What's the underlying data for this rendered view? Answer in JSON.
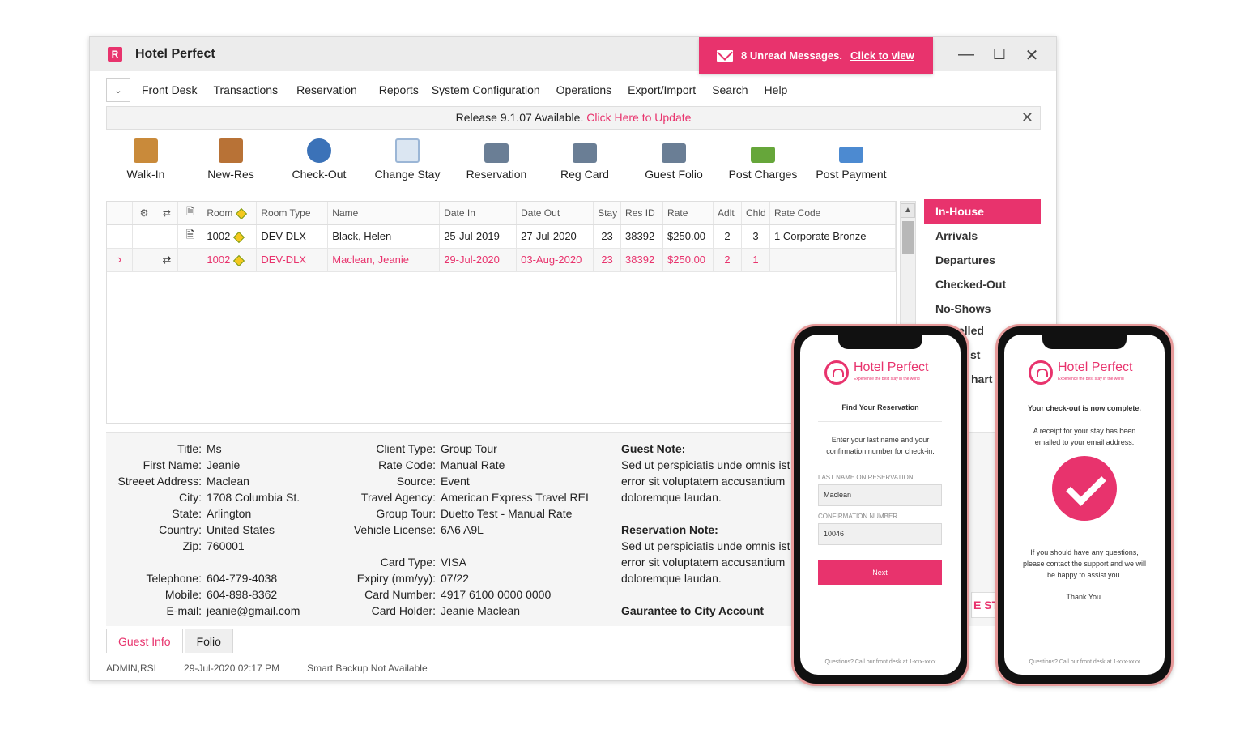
{
  "window": {
    "title": "Hotel Perfect",
    "logo_letter": "R",
    "controls": {
      "minimize": "—",
      "maximize": "☐",
      "close": "✕"
    }
  },
  "messages": {
    "text": "8 Unread Messages.",
    "link": "Click to view"
  },
  "menu": {
    "dropdown": "⌄",
    "items": [
      "Front Desk",
      "Transactions",
      "Reservation",
      "Reports",
      "System Configuration",
      "Operations",
      "Export/Import",
      "Search",
      "Help"
    ]
  },
  "release": {
    "text": "Release 9.1.07 Available.",
    "link": "Click Here to Update",
    "close": "✕"
  },
  "toolbar": [
    {
      "label": "Walk-In",
      "icon": "walk-in-icon",
      "color": "#c98a3a"
    },
    {
      "label": "New-Res",
      "icon": "phonebook-icon",
      "color": "#b87236"
    },
    {
      "label": "Check-Out",
      "icon": "person-exit-icon",
      "color": "#3b72b8"
    },
    {
      "label": "Change Stay",
      "icon": "notepad-icon",
      "color": "#9bb6d6"
    },
    {
      "label": "Reservation",
      "icon": "printer-icon",
      "color": "#6a7e95"
    },
    {
      "label": "Reg Card",
      "icon": "printer-icon",
      "color": "#6a7e95"
    },
    {
      "label": "Guest Folio",
      "icon": "printer-icon",
      "color": "#6a7e95"
    },
    {
      "label": "Post Charges",
      "icon": "cash-icon",
      "color": "#66a63a"
    },
    {
      "label": "Post Payment",
      "icon": "card-icon",
      "color": "#4c8ad1"
    }
  ],
  "grid": {
    "headers": [
      "",
      "",
      "",
      "",
      "Room",
      "Room Type",
      "Name",
      "Date In",
      "Date Out",
      "Stay",
      "Res ID",
      "Rate",
      "Adlt",
      "Chld",
      "Rate Code"
    ],
    "rows": [
      {
        "marker": "",
        "swap": "",
        "doc": "🗎",
        "room": "1002",
        "type": "DEV-DLX",
        "name": "Black, Helen",
        "date_in": "25-Jul-2019",
        "date_out": "27-Jul-2020",
        "stay": "23",
        "res_id": "38392",
        "rate": "$250.00",
        "adlt": "2",
        "chld": "3",
        "rate_code": "1 Corporate Bronze"
      },
      {
        "marker": "›",
        "swap": "⇄",
        "doc": "",
        "room": "1002",
        "type": "DEV-DLX",
        "name": "Maclean, Jeanie",
        "date_in": "29-Jul-2020",
        "date_out": "03-Aug-2020",
        "stay": "23",
        "res_id": "38392",
        "rate": "$250.00",
        "adlt": "2",
        "chld": "1",
        "rate_code": ""
      }
    ]
  },
  "side_list": [
    "In-House",
    "Arrivals",
    "Departures",
    "Checked-Out",
    "No-Shows"
  ],
  "side_list_partial": [
    "elled",
    "st",
    "hart"
  ],
  "guest": {
    "labels": [
      "Title:",
      "First Name:",
      "Streeet Address:",
      "City:",
      "State:",
      "Country:",
      "Zip:",
      "",
      "Telephone:",
      "Mobile:",
      "E-mail:"
    ],
    "values": [
      "Ms",
      "Jeanie",
      "Maclean",
      "1708 Columbia St.",
      "Arlington",
      "United States",
      "760001",
      "",
      "604-779-4038",
      "604-898-8362",
      "jeanie@gmail.com"
    ]
  },
  "client": {
    "labels": [
      "Client Type:",
      "Rate Code:",
      "Source:",
      "Travel Agency:",
      "Group Tour:",
      "Vehicle License:",
      "",
      "Card Type:",
      "Expiry (mm/yy):",
      "Card Number:",
      "Card Holder:"
    ],
    "values": [
      "Group Tour",
      "Manual Rate",
      "Event",
      "American Express Travel REI",
      "Duetto Test - Manual Rate",
      "6A6 A9L",
      "",
      "VISA",
      "07/22",
      "4917 6100 0000 0000",
      "Jeanie Maclean"
    ]
  },
  "notes": {
    "guest_heading": "Guest Note:",
    "guest_lines": [
      "Sed ut perspiciatis unde omnis ist",
      "error sit voluptatem accusantium",
      "doloremque laudan."
    ],
    "res_heading": "Reservation Note:",
    "res_lines": [
      "Sed ut perspiciatis unde omnis ist",
      "error sit voluptatem accusantium",
      "doloremque laudan."
    ],
    "guarantee": "Gaurantee to City Account",
    "partial_button": "E ST"
  },
  "tabs": [
    "Guest Info",
    "Folio"
  ],
  "status": [
    "ADMIN,RSI",
    "29-Jul-2020 02:17 PM",
    "Smart Backup Not Available"
  ],
  "phone1": {
    "brand": "Hotel Perfect",
    "tagline": "Experience the best stay in the world",
    "heading": "Find Your Reservation",
    "instructions": "Enter your last name and your confirmation number for check-in.",
    "last_name_label": "LAST NAME ON RESERVATION",
    "last_name_value": "Maclean",
    "conf_label": "CONFIRMATION NUMBER",
    "conf_value": "10046",
    "button": "Next",
    "footer": "Questions? Call our front desk at 1-xxx-xxxx"
  },
  "phone2": {
    "brand": "Hotel Perfect",
    "tagline": "Experience the best stay in the world",
    "heading": "Your check-out is now complete.",
    "receipt": "A receipt for your stay has been emailed to your email address.",
    "questions": "If you should have any questions, please contact the support and we will be happy to assist you.",
    "thanks": "Thank You.",
    "footer": "Questions? Call our front desk at 1-xxx-xxxx"
  },
  "colors": {
    "accent": "#e8336d",
    "phone_border": "#e79a9a"
  }
}
